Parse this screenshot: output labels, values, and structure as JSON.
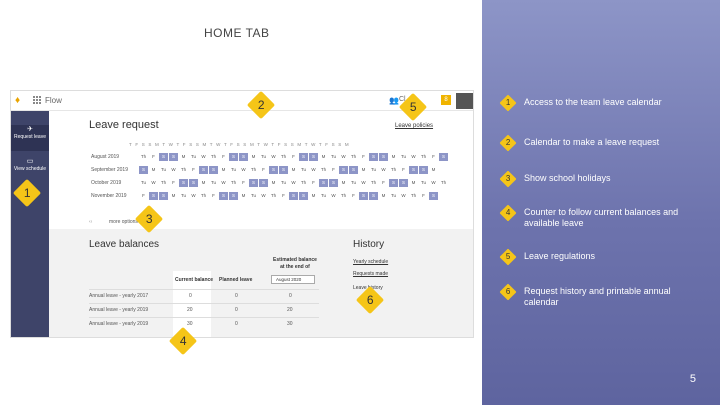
{
  "slide": {
    "title": "HOME TAB",
    "page_number": "5"
  },
  "app": {
    "name": "Flow",
    "user_name": "Cl",
    "badge": "8"
  },
  "sidebar": {
    "items": [
      {
        "label": "Request leave"
      },
      {
        "label": "View schedule"
      }
    ]
  },
  "leave_request": {
    "title": "Leave request",
    "policies_link": "Leave policies",
    "day_header": "T F S S M T W T F S S M T W T F S S M T W T F S S M T W T F S S M",
    "months": [
      {
        "label": "August 2019",
        "days": [
          "Th",
          "F",
          "S",
          "S",
          "M",
          "Tu",
          "W",
          "Th",
          "F",
          "S",
          "S",
          "M",
          "Tu",
          "W",
          "Th",
          "F",
          "S",
          "S",
          "M",
          "Tu",
          "W",
          "Th",
          "F",
          "S",
          "S",
          "M",
          "Tu",
          "W",
          "Th",
          "F",
          "S"
        ]
      },
      {
        "label": "September 2019",
        "days": [
          "S",
          "M",
          "Tu",
          "W",
          "Th",
          "F",
          "S",
          "S",
          "M",
          "Tu",
          "W",
          "Th",
          "F",
          "S",
          "S",
          "M",
          "Tu",
          "W",
          "Th",
          "F",
          "S",
          "S",
          "M",
          "Tu",
          "W",
          "Th",
          "F",
          "S",
          "S",
          "M"
        ]
      },
      {
        "label": "October 2019",
        "days": [
          "Tu",
          "W",
          "Th",
          "F",
          "S",
          "S",
          "M",
          "Tu",
          "W",
          "Th",
          "F",
          "S",
          "S",
          "M",
          "Tu",
          "W",
          "Th",
          "F",
          "S",
          "S",
          "M",
          "Tu",
          "W",
          "Th",
          "F",
          "S",
          "S",
          "M",
          "Tu",
          "W",
          "Th"
        ]
      },
      {
        "label": "November 2019",
        "days": [
          "F",
          "S",
          "S",
          "M",
          "Tu",
          "W",
          "Th",
          "F",
          "S",
          "S",
          "M",
          "Tu",
          "W",
          "Th",
          "F",
          "S",
          "S",
          "M",
          "Tu",
          "W",
          "Th",
          "F",
          "S",
          "S",
          "M",
          "Tu",
          "W",
          "Th",
          "F",
          "S"
        ]
      }
    ],
    "more_options": "more options"
  },
  "leave_balances": {
    "title": "Leave balances",
    "col_current": "Current balance",
    "col_planned": "Planned leave",
    "col_estimated": "Estimated balance at the end of",
    "estimated_select": "August 2020",
    "rows": [
      {
        "type": "Annual leave - yearly 2017",
        "current": "0",
        "planned": "0",
        "estimated": "0"
      },
      {
        "type": "Annual leave - yearly 2019",
        "current": "20",
        "planned": "0",
        "estimated": "20"
      },
      {
        "type": "Annual leave - yearly 2019",
        "current": "30",
        "planned": "0",
        "estimated": "30"
      }
    ]
  },
  "history": {
    "title": "History",
    "links": [
      "Yearly schedule",
      "Requests made"
    ],
    "item": "Leave history"
  },
  "callouts": [
    "1",
    "2",
    "3",
    "4",
    "5",
    "6"
  ],
  "legend": [
    {
      "num": "1",
      "text": "Access to the team leave calendar"
    },
    {
      "num": "2",
      "text": "Calendar to make a leave request"
    },
    {
      "num": "3",
      "text": "Show school holidays"
    },
    {
      "num": "4",
      "text": "Counter to follow current balances and available leave"
    },
    {
      "num": "5",
      "text": "Leave regulations"
    },
    {
      "num": "6",
      "text": "Request history and printable annual calendar"
    }
  ],
  "colors": {
    "sidebar": "#3e4469",
    "weekend": "#8d95c7",
    "panel": "#6d73ad",
    "marker": "#f5c518"
  }
}
